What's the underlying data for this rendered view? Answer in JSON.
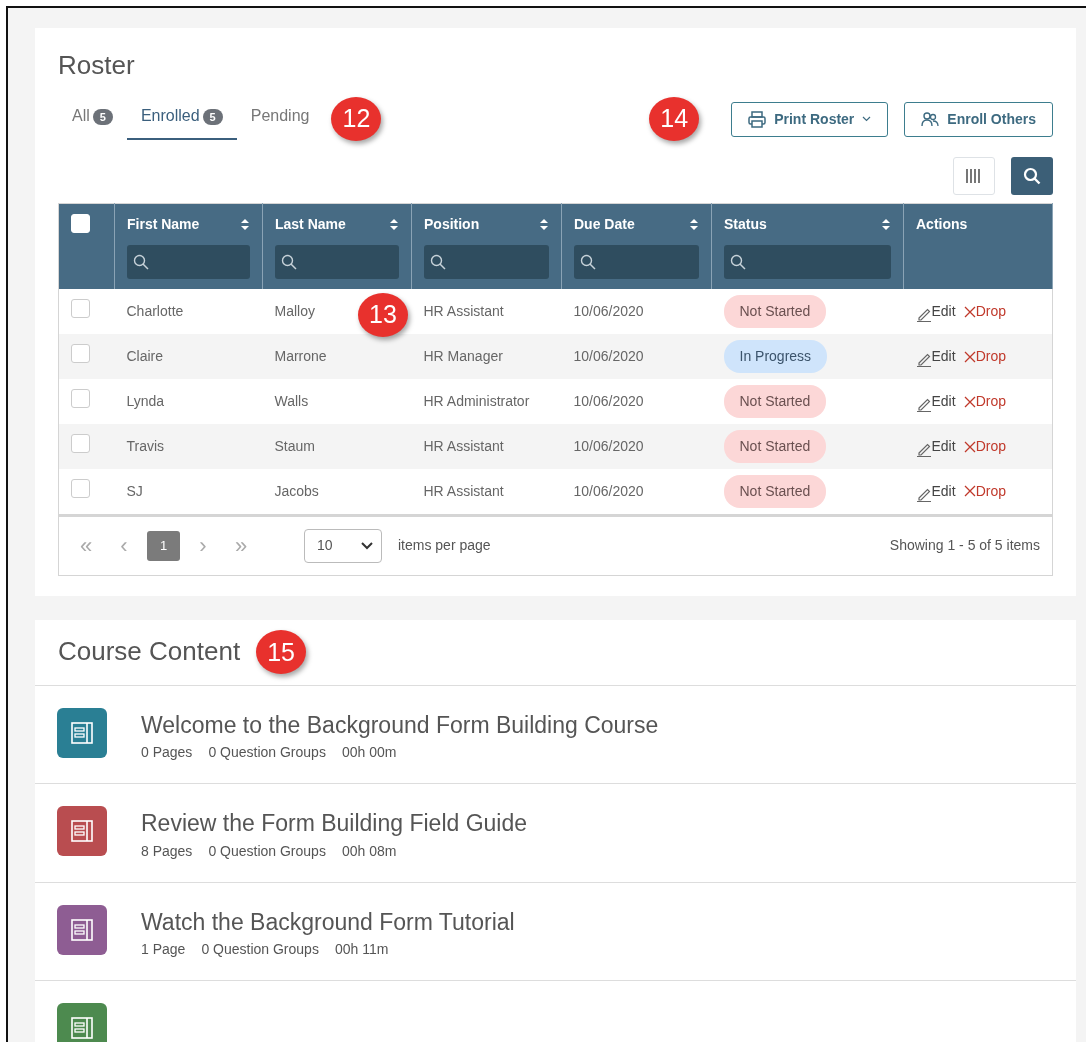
{
  "roster": {
    "title": "Roster",
    "tabs": [
      {
        "label": "All",
        "count": "5",
        "selected": false
      },
      {
        "label": "Enrolled",
        "count": "5",
        "selected": true
      },
      {
        "label": "Pending",
        "selected": false
      }
    ],
    "callouts": [
      "12",
      "13",
      "14",
      "15"
    ],
    "buttons": [
      {
        "label": "Print Roster",
        "kind": "print"
      },
      {
        "label": "Enroll Others",
        "kind": "enroll"
      }
    ],
    "table": {
      "select_all_checked": false,
      "columns": [
        {
          "label": "First Name",
          "sortable": true,
          "filter": true
        },
        {
          "label": "Last Name",
          "sortable": true,
          "filter": true
        },
        {
          "label": "Position",
          "sortable": true,
          "filter": true
        },
        {
          "label": "Due Date",
          "sortable": true,
          "filter": true
        },
        {
          "label": "Status",
          "sortable": true,
          "filter": true
        },
        {
          "label": "Actions",
          "sortable": false,
          "filter": false
        }
      ],
      "rows": [
        {
          "checked": false,
          "cells": [
            "Charlotte",
            "Malloy",
            "HR Assistant",
            "10/06/2020"
          ],
          "status": {
            "text": "Not Started",
            "kind": "notstarted"
          },
          "actions": [
            "Edit",
            "Drop"
          ]
        },
        {
          "checked": false,
          "cells": [
            "Claire",
            "Marrone",
            "HR Manager",
            "10/06/2020"
          ],
          "status": {
            "text": "In Progress",
            "kind": "inprogress"
          },
          "actions": [
            "Edit",
            "Drop"
          ]
        },
        {
          "checked": false,
          "cells": [
            "Lynda",
            "Walls",
            "HR Administrator",
            "10/06/2020"
          ],
          "status": {
            "text": "Not Started",
            "kind": "notstarted"
          },
          "actions": [
            "Edit",
            "Drop"
          ]
        },
        {
          "checked": false,
          "cells": [
            "Travis",
            "Staum",
            "HR Assistant",
            "10/06/2020"
          ],
          "status": {
            "text": "Not Started",
            "kind": "notstarted"
          },
          "actions": [
            "Edit",
            "Drop"
          ]
        },
        {
          "checked": false,
          "cells": [
            "SJ",
            "Jacobs",
            "HR Assistant",
            "10/06/2020"
          ],
          "status": {
            "text": "Not Started",
            "kind": "notstarted"
          },
          "actions": [
            "Edit",
            "Drop"
          ]
        }
      ]
    },
    "pagination": {
      "first": "«",
      "prev": "‹",
      "pages": [
        {
          "label": "1",
          "selected": true
        }
      ],
      "next": "›",
      "last": "»",
      "page_size": "10",
      "page_size_label": "items per page",
      "summary": "Showing 1 - 5 of 5 items"
    }
  },
  "course_content": {
    "title": "Course Content",
    "items": [
      {
        "title": "Welcome to the Background Form Building Course",
        "meta": [
          "0 Pages",
          "0 Question Groups",
          "00h 00m"
        ],
        "color": "#2a7f94"
      },
      {
        "title": "Review the Form Building Field Guide",
        "meta": [
          "8 Pages",
          "0 Question Groups",
          "00h 08m"
        ],
        "color": "#b94d50"
      },
      {
        "title": "Watch the Background Form Tutorial",
        "meta": [
          "1 Page",
          "0 Question Groups",
          "00h 11m"
        ],
        "color": "#8e5d93"
      },
      {
        "color": "#4d8a4f"
      }
    ]
  }
}
